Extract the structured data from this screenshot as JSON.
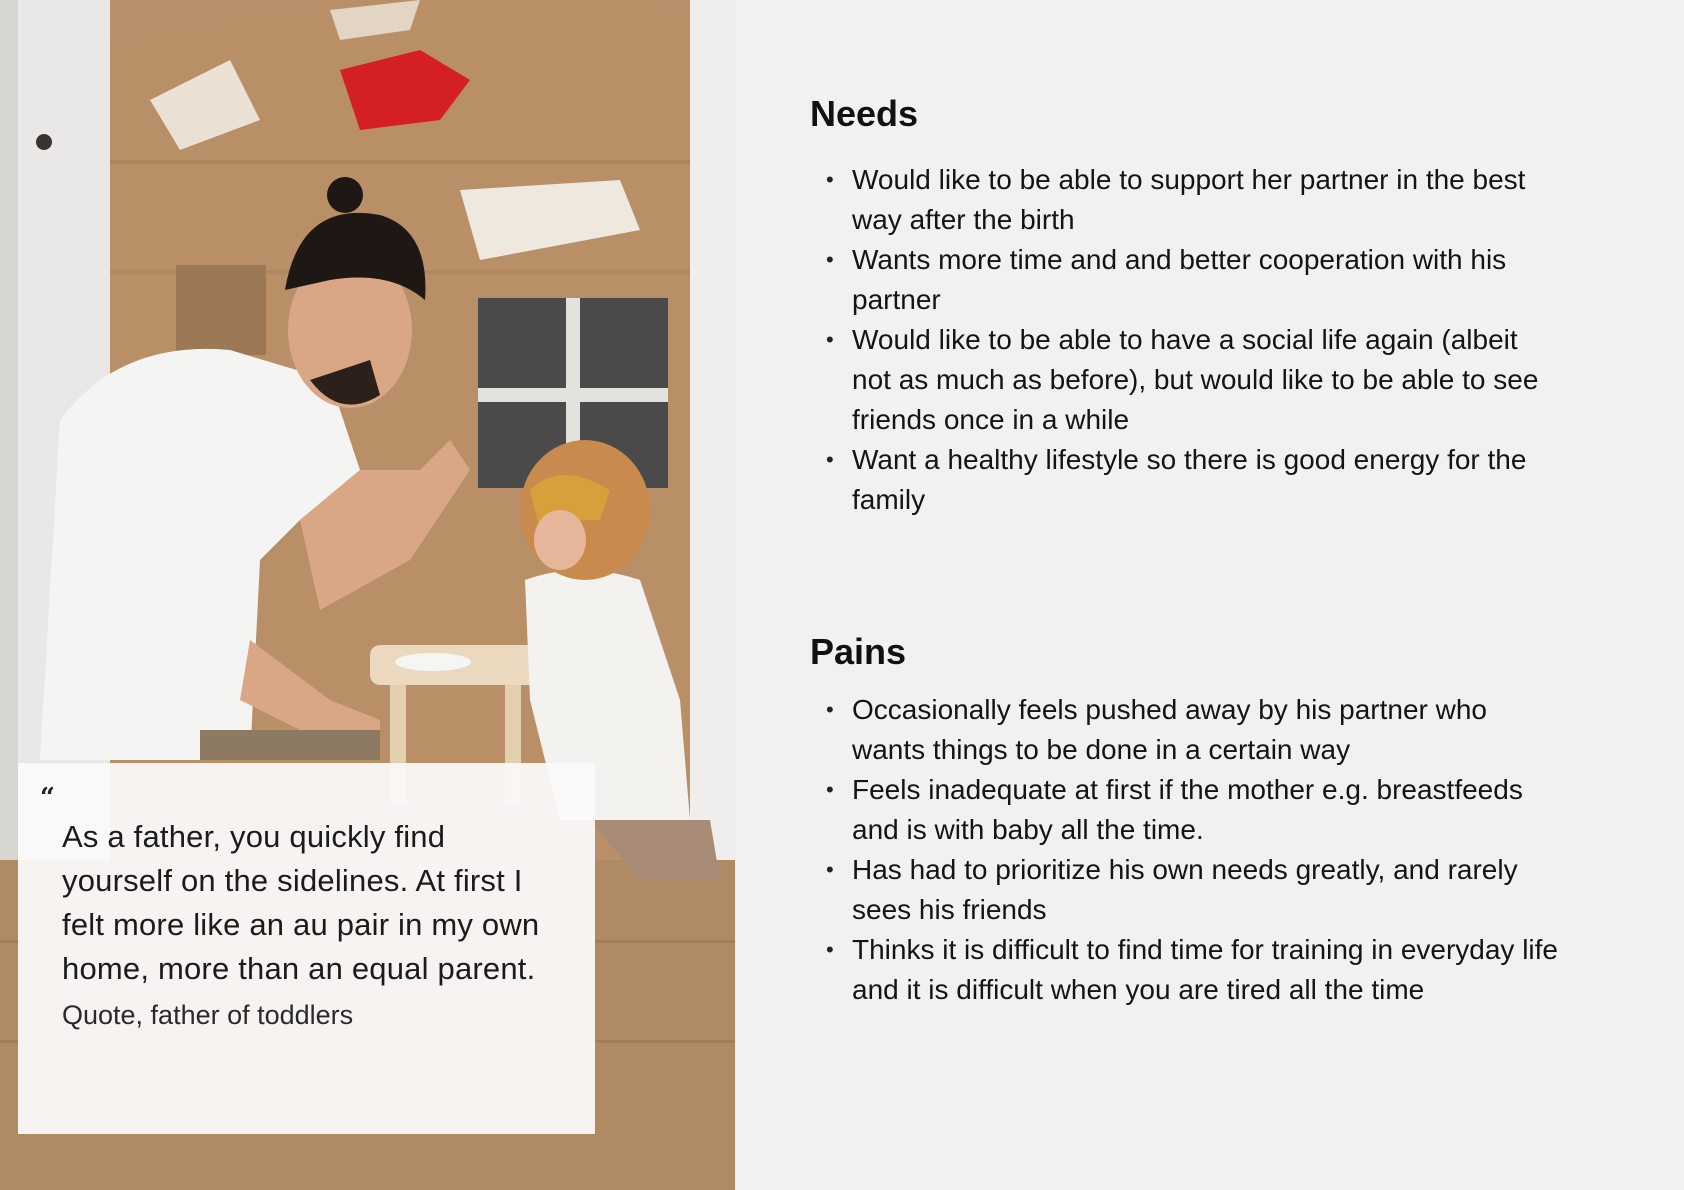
{
  "quote": {
    "mark": "“",
    "text": "As a father, you quickly find yourself on the sidelines. At first I felt more like an au pair in my own home, more than an equal parent.",
    "attribution": "Quote, father of toddlers"
  },
  "needs": {
    "title": "Needs",
    "items": [
      "Would like to be able to support her partner in the best way after the birth",
      "Wants more time and and better cooperation with his partner",
      "Would like to be able to have a social life again (albeit not as much as before), but would like to be able to see friends once in a while",
      "Want a healthy lifestyle so there is good energy for the family"
    ]
  },
  "pains": {
    "title": "Pains",
    "items": [
      "Occasionally feels pushed away by his partner who wants things to be done in a certain way",
      "Feels inadequate at first if the mother e.g. breastfeeds and is with baby all the time.",
      "Has had to prioritize his own needs greatly, and rarely sees his friends",
      "Thinks it is difficult to find time for training in everyday life and it is difficult when you are tired all the time"
    ]
  },
  "bullet_glyph": "•",
  "colors": {
    "background": "#f1f1f1",
    "card": "#fafafa",
    "text": "#111111",
    "cardboard": "#b8916c"
  },
  "icons": {
    "photo": "father-and-child-painting-cardboard-house-image"
  }
}
